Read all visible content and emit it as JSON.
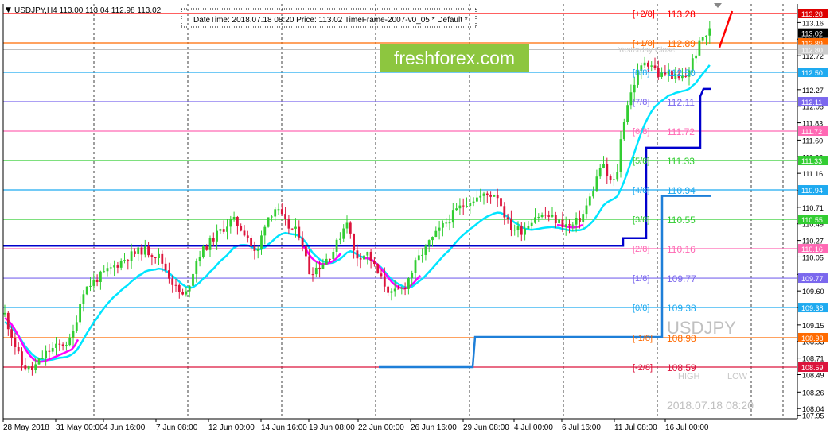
{
  "header": {
    "menu_glyph": "▼",
    "symbol_info": "USDJPY,H4  113.00 113.04 112.98 113.02",
    "info_line": "DateTime: 2018.07.18 08:20    Price: 113.02    TimeFrame-2007-v0_05    *  Default   *"
  },
  "watermark": {
    "brand": "freshforex.com",
    "symbol": "USDJPY",
    "datetime": "2018.07.18 08:20",
    "high_label": "HIGH",
    "low_label": "LOW",
    "yesterday_label": "Yesterday Close"
  },
  "colors": {
    "bull": "#32cd32",
    "bear": "#dc143c",
    "background": "#ffffff",
    "axis": "#000000"
  },
  "chart_data": {
    "type": "candlestick",
    "symbol": "USDJPY",
    "timeframe": "H4",
    "ylim": [
      107.85,
      113.45
    ],
    "last_price": 113.02,
    "y_ticks": [
      113.16,
      112.94,
      112.72,
      112.27,
      112.05,
      111.83,
      111.6,
      111.38,
      111.16,
      110.93,
      110.71,
      110.49,
      110.27,
      110.05,
      109.82,
      109.6,
      109.38,
      109.15,
      108.93,
      108.71,
      108.49,
      108.26,
      108.04,
      107.95
    ],
    "x_ticks": [
      "28 May 2018",
      "31 May 00:00",
      "4 Jun 16:00",
      "7 Jun 08:00",
      "12 Jun 00:00",
      "14 Jun 16:00",
      "19 Jun 08:00",
      "22 Jun 00:00",
      "26 Jun 16:00",
      "29 Jun 08:00",
      "4 Jul 00:00",
      "6 Jul 16:00",
      "11 Jul 08:00",
      "16 Jul 00:00"
    ],
    "murray_levels": [
      {
        "name": "[+2/8]",
        "value": 113.28,
        "color": "#ff0000",
        "tag_color": "#dd0000"
      },
      {
        "name": "[+1/8]",
        "value": 112.89,
        "color": "#ff6a00",
        "tag_color": "#ff6a00"
      },
      {
        "name": "[8/8]",
        "value": 112.5,
        "color": "#1eaaf0",
        "tag_color": "#1eaaf0"
      },
      {
        "name": "[7/8]",
        "value": 112.11,
        "color": "#7b68ee",
        "tag_color": "#7b68ee"
      },
      {
        "name": "[6/8]",
        "value": 111.72,
        "color": "#ff69b4",
        "tag_color": "#ff69b4"
      },
      {
        "name": "[5/8]",
        "value": 111.33,
        "color": "#32cd32",
        "tag_color": "#32cd32"
      },
      {
        "name": "[4/8]",
        "value": 110.94,
        "color": "#1eaaf0",
        "tag_color": "#1eaaf0"
      },
      {
        "name": "[3/8]",
        "value": 110.55,
        "color": "#32cd32",
        "tag_color": "#32cd32"
      },
      {
        "name": "[2/8]",
        "value": 110.16,
        "color": "#ff69b4",
        "tag_color": "#ff69b4"
      },
      {
        "name": "[1/8]",
        "value": 109.77,
        "color": "#7b68ee",
        "tag_color": "#7b68ee"
      },
      {
        "name": "[0/8]",
        "value": 109.38,
        "color": "#1eaaf0",
        "tag_color": "#1eaaf0"
      },
      {
        "name": "[-1/8]",
        "value": 108.98,
        "color": "#ff6a00",
        "tag_color": "#ff6a00"
      },
      {
        "name": "[-2/8]",
        "value": 108.59,
        "color": "#dc143c",
        "tag_color": "#dc143c"
      }
    ],
    "yesterday_close": 112.8,
    "yesterday_close_color": "#c0c0c0",
    "grid": true
  }
}
